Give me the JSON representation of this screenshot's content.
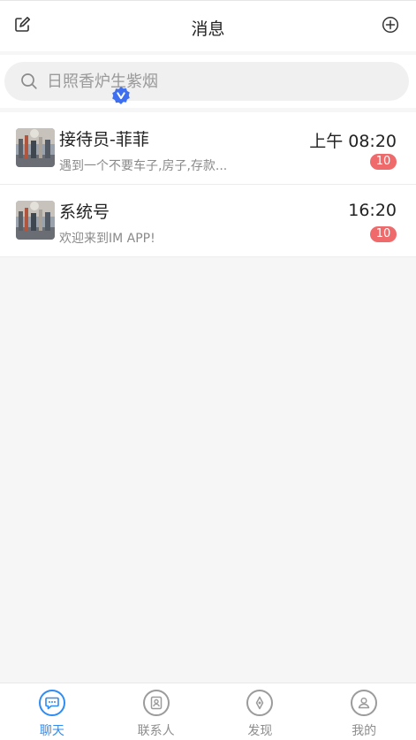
{
  "header": {
    "title": "消息",
    "edit_icon": "edit-icon",
    "add_icon": "add-circle-icon"
  },
  "search": {
    "placeholder": "日照香炉生紫烟",
    "value": ""
  },
  "conversations": [
    {
      "name": "接待员-菲菲",
      "preview": "遇到一个不要车子,房子,存款...",
      "time": "上午 08:20",
      "unread": "10",
      "verified": false
    },
    {
      "name": "系统号",
      "preview": "欢迎来到IM APP!",
      "time": "16:20",
      "unread": "10",
      "verified": true
    }
  ],
  "tabs": [
    {
      "label": "聊天",
      "icon": "chat-icon",
      "active": true
    },
    {
      "label": "联系人",
      "icon": "contacts-icon",
      "active": false
    },
    {
      "label": "发现",
      "icon": "discover-icon",
      "active": false
    },
    {
      "label": "我的",
      "icon": "profile-icon",
      "active": false
    }
  ],
  "colors": {
    "accent": "#2f8cf3",
    "badge": "#ef6b6b",
    "verified": "#3d6ff0"
  }
}
